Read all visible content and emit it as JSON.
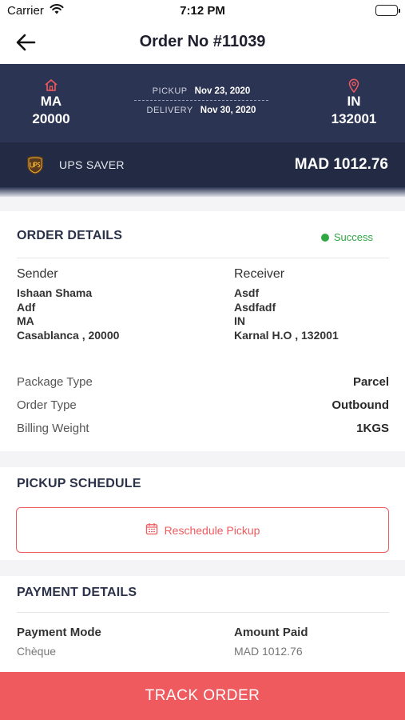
{
  "status_bar": {
    "carrier": "Carrier",
    "time": "7:12 PM"
  },
  "header": {
    "title": "Order No #11039"
  },
  "route": {
    "origin": {
      "code": "MA",
      "zip": "20000"
    },
    "destination": {
      "code": "IN",
      "zip": "132001"
    },
    "pickup_label": "PICKUP",
    "pickup_date": "Nov 23, 2020",
    "delivery_label": "DELIVERY",
    "delivery_date": "Nov 30, 2020"
  },
  "carrier": {
    "name": "UPS SAVER",
    "price": "MAD 1012.76"
  },
  "order_details": {
    "title": "ORDER DETAILS",
    "status": "Success",
    "sender": {
      "label": "Sender",
      "lines": [
        "Ishaan Shama",
        "Adf",
        "MA",
        "Casablanca , 20000"
      ]
    },
    "receiver": {
      "label": "Receiver",
      "lines": [
        "Asdf",
        "Asdfadf",
        "IN",
        "Karnal H.O , 132001"
      ]
    },
    "attributes": [
      {
        "label": "Package Type",
        "value": "Parcel"
      },
      {
        "label": "Order Type",
        "value": "Outbound"
      },
      {
        "label": "Billing Weight",
        "value": "1KGS"
      }
    ]
  },
  "pickup_schedule": {
    "title": "PICKUP SCHEDULE",
    "reschedule_label": "Reschedule Pickup"
  },
  "payment_details": {
    "title": "PAYMENT DETAILS",
    "mode_label": "Payment Mode",
    "mode_value": "Chèque",
    "amount_label": "Amount Paid",
    "amount_value": "MAD 1012.76"
  },
  "footer": {
    "track_label": "TRACK ORDER"
  },
  "colors": {
    "navy": "#2b3452",
    "accent": "#ef5a5f",
    "success": "#2fa844"
  }
}
